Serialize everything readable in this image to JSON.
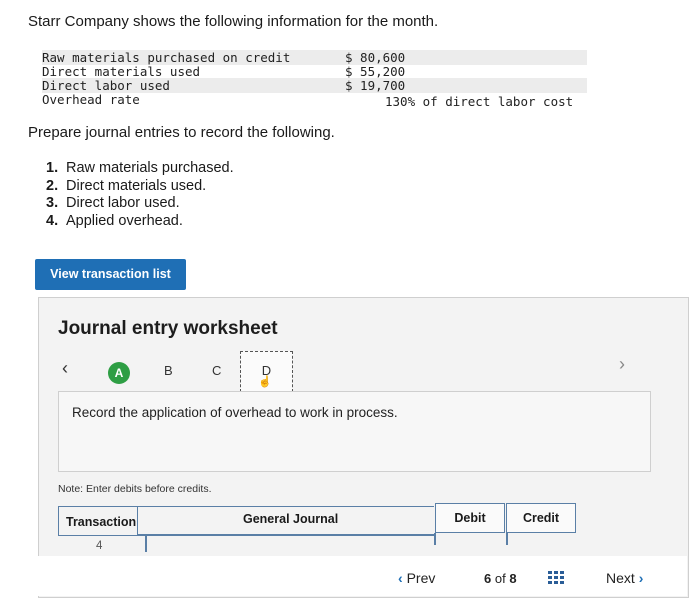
{
  "intro": "Starr Company shows the following information for the month.",
  "info_rows": [
    {
      "label": "Raw materials purchased on credit",
      "amount": "$ 80,600"
    },
    {
      "label": "Direct materials used",
      "amount": "$ 55,200"
    },
    {
      "label": "Direct labor used",
      "amount": "$ 19,700"
    },
    {
      "label": "Overhead rate",
      "amount": "130% of direct labor cost"
    }
  ],
  "prepare_text": "Prepare journal entries to record the following.",
  "tasks": [
    {
      "num": "1.",
      "text": "Raw materials purchased."
    },
    {
      "num": "2.",
      "text": "Direct materials used."
    },
    {
      "num": "3.",
      "text": "Direct labor used."
    },
    {
      "num": "4.",
      "text": "Applied overhead."
    }
  ],
  "view_button": "View transaction list",
  "worksheet": {
    "title": "Journal entry worksheet",
    "steps": [
      "A",
      "B",
      "C",
      "D"
    ],
    "instruction": "Record the application of overhead to work in process.",
    "note": "Note: Enter debits before credits.",
    "headers": {
      "transaction": "Transaction",
      "general_journal": "General Journal",
      "debit": "Debit",
      "credit": "Credit"
    },
    "row_number": "4"
  },
  "footer": {
    "prev": "Prev",
    "current_page": "6",
    "of": "of",
    "total_pages": "8",
    "next": "Next"
  },
  "icons": [
    "chevron-left-icon",
    "chevron-right-icon",
    "hand-cursor-icon",
    "grid-icon"
  ],
  "colors": {
    "accent": "#1f6fb5",
    "step_active": "#2e9e44"
  }
}
